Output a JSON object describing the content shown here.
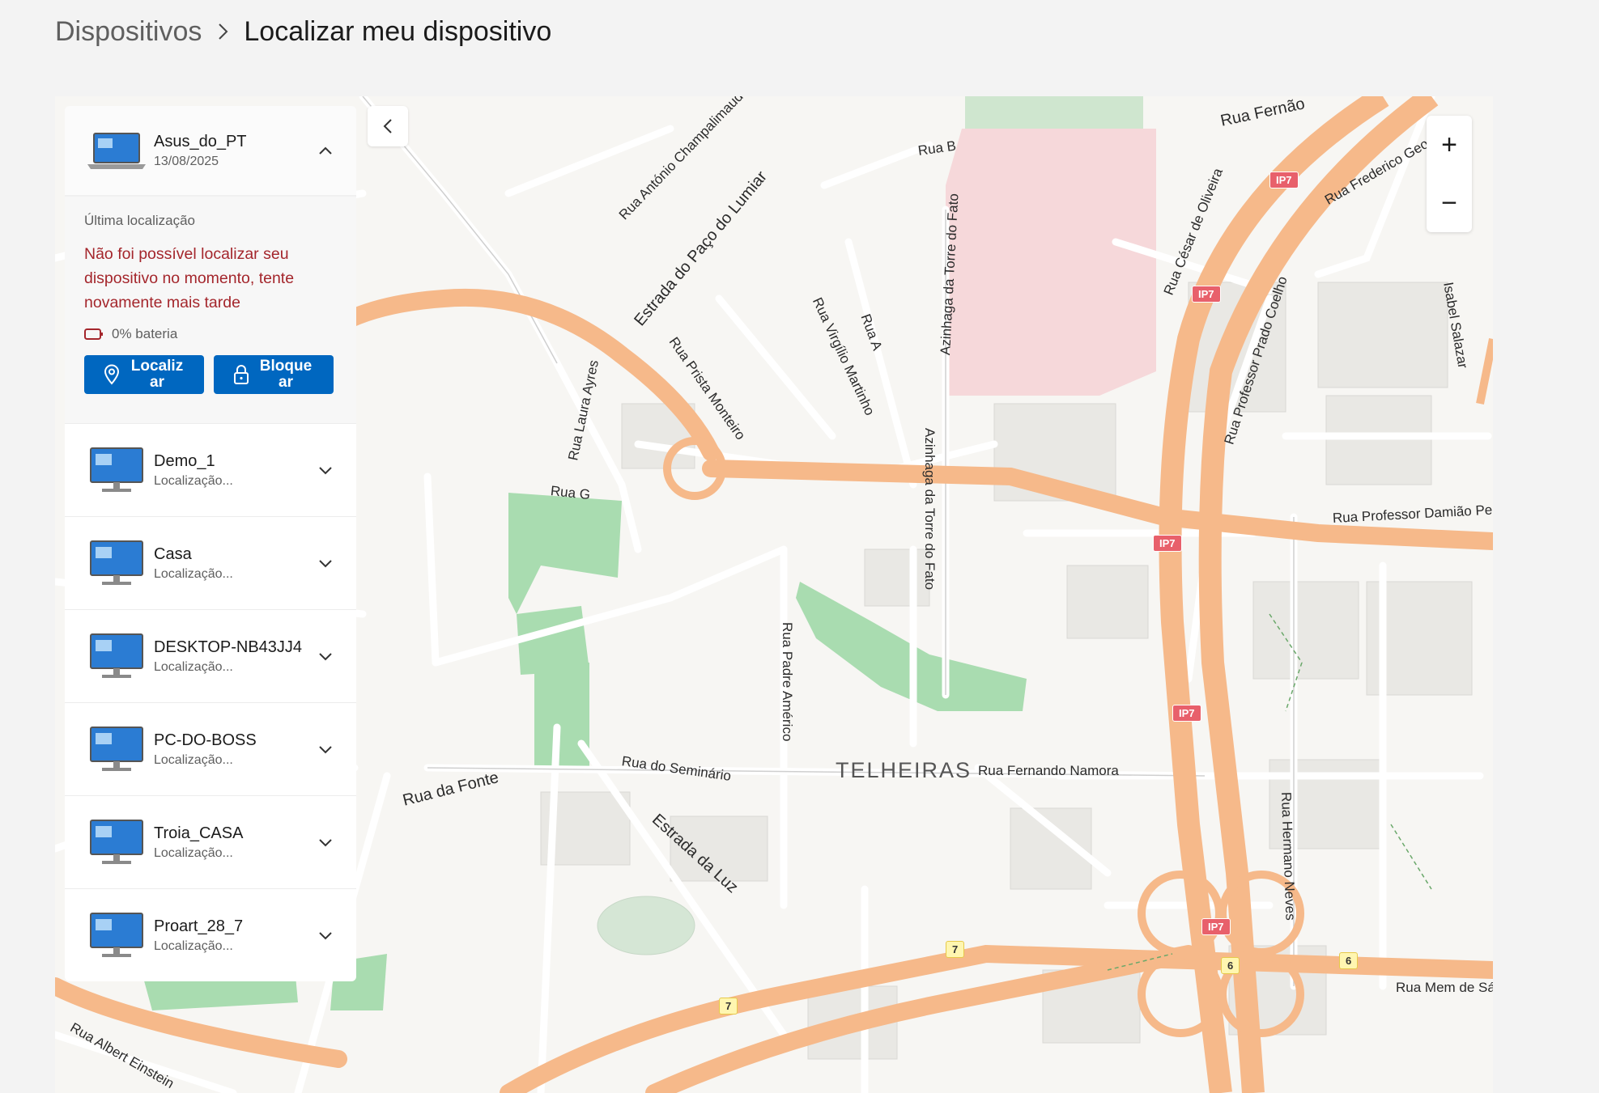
{
  "breadcrumb": {
    "parent": "Dispositivos",
    "current": "Localizar meu dispositivo"
  },
  "selected_device": {
    "name": "Asus_do_PT",
    "date": "13/08/2025",
    "last_location_label": "Última localização",
    "error": "Não foi possível localizar seu dispositivo no momento, tente novamente mais tarde",
    "battery": "0% bateria",
    "locate_label": "Localiz ar",
    "lock_label": "Bloque ar"
  },
  "devices": [
    {
      "name": "Demo_1",
      "status": "Localização..."
    },
    {
      "name": "Casa",
      "status": "Localização..."
    },
    {
      "name": "DESKTOP-NB43JJ4",
      "status": "Localização..."
    },
    {
      "name": "PC-DO-BOSS",
      "status": "Localização..."
    },
    {
      "name": "Troia_CASA",
      "status": "Localização..."
    },
    {
      "name": "Proart_28_7",
      "status": "Localização..."
    }
  ],
  "map": {
    "zoom_in": "+",
    "zoom_out": "−",
    "town": "TELHEIRAS",
    "streets": {
      "s1": "Rua António Champalimaud",
      "s2": "Estrada do Paço do Lumiar",
      "s3": "Rua B",
      "s4": "Azinhaga da Torre do Fato",
      "s5": "Rua Fernão",
      "s6": "Rua Frederico George",
      "s7": "Rua César de Oliveira",
      "s8": "Rua Professor Prado Coelho",
      "s9": "Rua Virgílio Martinho",
      "s10": "Rua A",
      "s11": "Rua Prista Monteiro",
      "s12": "Rua Laura Ayres",
      "s13": "Rua G",
      "s14": "Azinhaga da Torre do Fato",
      "s15": "Rua Professor Damião Peres",
      "s16": "Rua Padre Américo",
      "s17": "Rua da Fonte",
      "s18": "Rua do Seminário",
      "s19": "Estrada da Luz",
      "s20": "Rua Fernando Namora",
      "s21": "Rua Hermano Neves",
      "s22": "Rua Albert Einstein",
      "s23": "Rua Mem de Sá",
      "s24": "Isabel Salazar"
    },
    "shields": {
      "ip7": "IP7",
      "r7": "7",
      "r6": "6"
    }
  }
}
